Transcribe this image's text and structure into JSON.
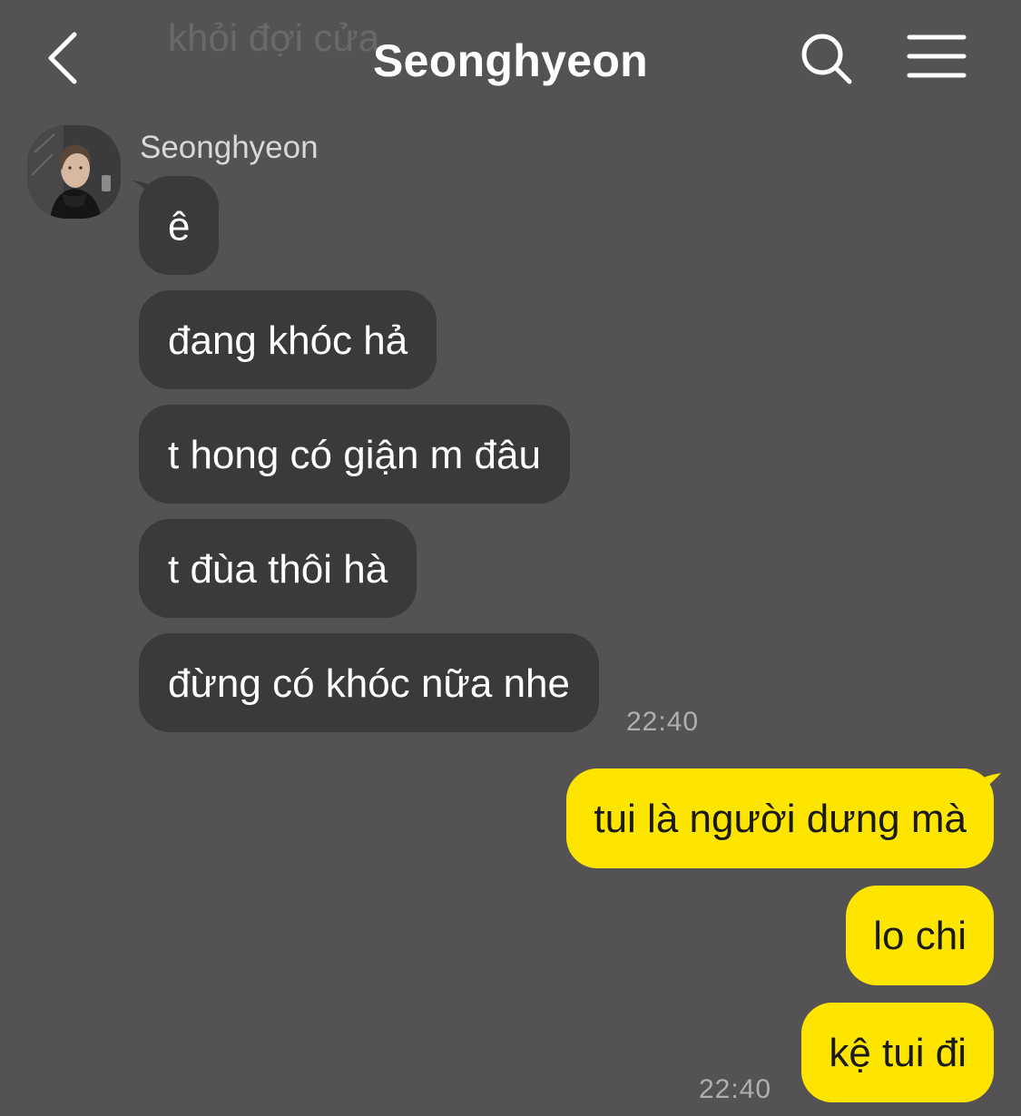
{
  "header": {
    "faded_text": "khỏi đợi cửa",
    "title": "Seonghyeon",
    "back_icon": "chevron-left-icon",
    "search_icon": "search-icon",
    "menu_icon": "hamburger-menu-icon"
  },
  "sender": {
    "name": "Seonghyeon"
  },
  "incoming": [
    {
      "text": "ê"
    },
    {
      "text": "đang khóc hả"
    },
    {
      "text": "t hong có giận m đâu"
    },
    {
      "text": "t đùa thôi hà"
    },
    {
      "text": "đừng có khóc nữa nhe"
    }
  ],
  "incoming_time": "22:40",
  "outgoing": [
    {
      "text": "tui là người dưng mà"
    },
    {
      "text": "lo chi"
    },
    {
      "text": "kệ tui đi"
    }
  ],
  "outgoing_time": "22:40",
  "colors": {
    "background": "#545254",
    "incoming_bubble": "#3a393b",
    "outgoing_bubble": "#fee500"
  }
}
